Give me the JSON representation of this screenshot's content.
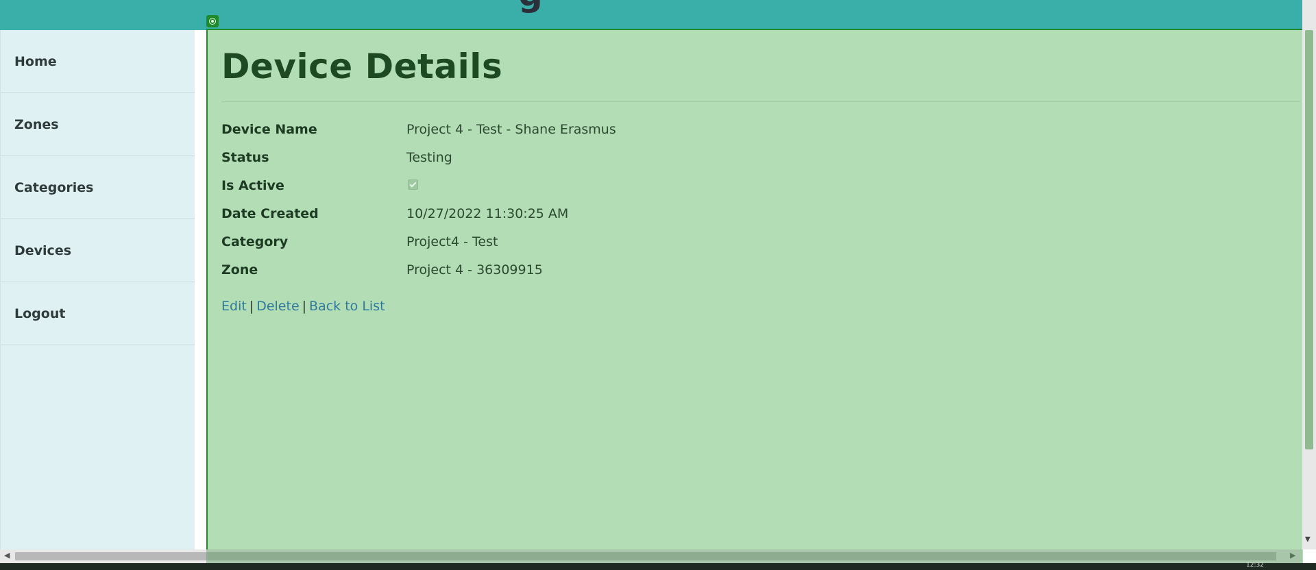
{
  "header": {
    "title_fragment": "g"
  },
  "sidebar": {
    "items": [
      {
        "label": "Home"
      },
      {
        "label": "Zones"
      },
      {
        "label": "Categories"
      },
      {
        "label": "Devices"
      },
      {
        "label": "Logout"
      }
    ]
  },
  "main": {
    "title": "Device Details",
    "fields": [
      {
        "label": "Device Name",
        "value": "Project 4 - Test - Shane Erasmus"
      },
      {
        "label": "Status",
        "value": "Testing"
      },
      {
        "label": "Is Active",
        "checked": true
      },
      {
        "label": "Date Created",
        "value": "10/27/2022 11:30:25 AM"
      },
      {
        "label": "Category",
        "value": "Project4 - Test"
      },
      {
        "label": "Zone",
        "value": "Project 4 - 36309915"
      }
    ],
    "actions": {
      "edit": "Edit",
      "delete": "Delete",
      "back": "Back to List",
      "separator": "|"
    }
  },
  "taskbar": {
    "clock": "12:32"
  },
  "colors": {
    "header": "#3aafa9",
    "sidebar": "#dff1f2",
    "content_overlay": "#b3ddb5",
    "link": "#2f7a9a"
  }
}
